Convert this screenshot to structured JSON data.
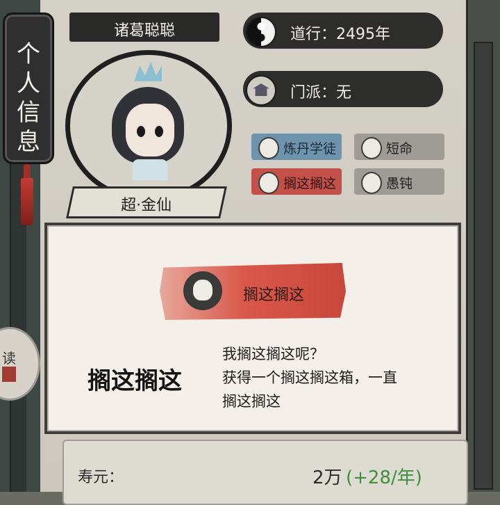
{
  "side_tab": {
    "label": "个\n人\n信\n息"
  },
  "read_button": {
    "label": "读"
  },
  "character": {
    "name": "诸葛聪聪",
    "rank": "超·金仙"
  },
  "stats": {
    "daoxing": "道行：2495年",
    "menpai": "门派：无"
  },
  "tags": [
    {
      "label": "炼丹学徒",
      "color": "#6e93ad"
    },
    {
      "label": "短命",
      "color": "#9d9c97"
    },
    {
      "label": "搁这搁这",
      "color": "#c45149"
    },
    {
      "label": "愚钝",
      "color": "#9d9c97"
    }
  ],
  "detail": {
    "banner_label": "搁这搁这",
    "title": "搁这搁这",
    "description_lines": [
      "我搁这搁这呢？",
      "获得一个搁这搁这箱，一直",
      "搁这搁这"
    ]
  },
  "lifespan": {
    "label": "寿元：",
    "value": "2万",
    "gain": "(+28/年)"
  }
}
